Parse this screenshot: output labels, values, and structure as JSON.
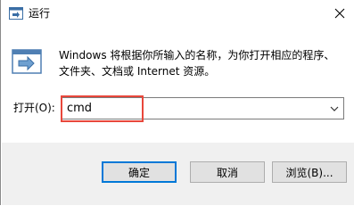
{
  "window": {
    "title": "运行",
    "icons": {
      "app": "run-app-icon",
      "close": "close-icon",
      "dropdown": "chevron-down-icon"
    }
  },
  "description": {
    "line1": "Windows 将根据你所输入的名称，为你打开相应的程序、",
    "line2": "文件夹、文档或 Internet 资源。"
  },
  "open_field": {
    "label": "打开(O):",
    "value": "cmd"
  },
  "buttons": {
    "ok": "确定",
    "cancel": "取消",
    "browse": "浏览(B)..."
  },
  "colors": {
    "highlight": "#e8473b",
    "default_button_border": "#0078d7",
    "footer_bg": "#f0f0f0"
  }
}
